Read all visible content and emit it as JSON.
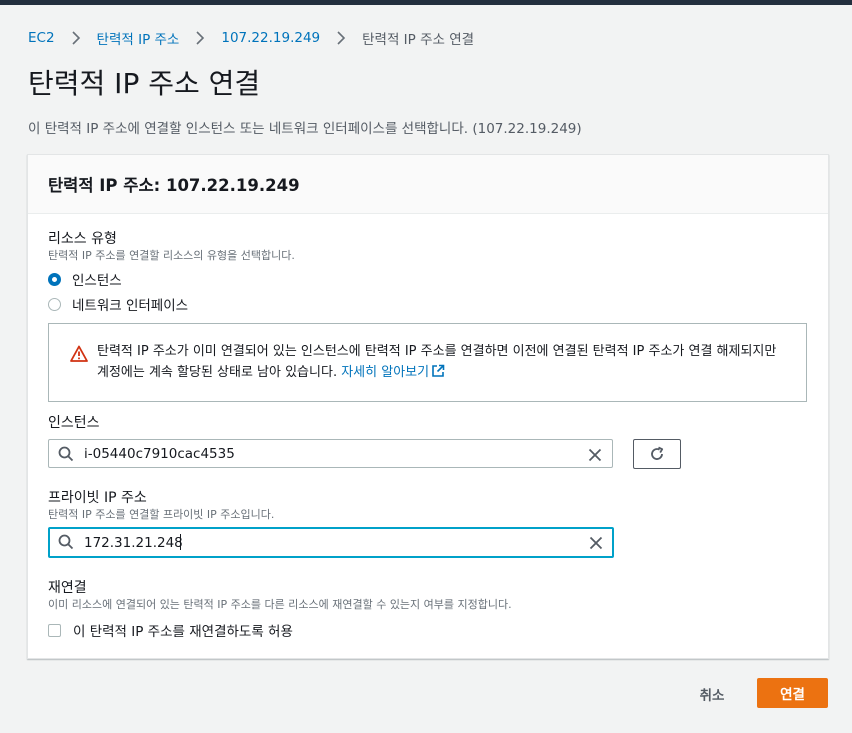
{
  "breadcrumb": {
    "items": [
      "EC2",
      "탄력적 IP 주소",
      "107.22.19.249"
    ],
    "current": "탄력적 IP 주소 연결"
  },
  "page": {
    "title": "탄력적 IP 주소 연결",
    "description": "이 탄력적 IP 주소에 연결할 인스턴스 또는 네트워크 인터페이스를 선택합니다. (107.22.19.249)"
  },
  "card": {
    "title": "탄력적 IP 주소: 107.22.19.249"
  },
  "resource_type": {
    "label": "리소스 유형",
    "description": "탄력적 IP 주소를 연결할 리소스의 유형을 선택합니다.",
    "options": [
      "인스턴스",
      "네트워크 인터페이스"
    ],
    "selected": "인스턴스"
  },
  "alert": {
    "text": "탄력적 IP 주소가 이미 연결되어 있는 인스턴스에 탄력적 IP 주소를 연결하면 이전에 연결된 탄력적 IP 주소가 연결 해제되지만 계정에는 계속 할당된 상태로 남아 있습니다. ",
    "link": "자세히 알아보기"
  },
  "instance": {
    "label": "인스턴스",
    "value": "i-05440c7910cac4535"
  },
  "private_ip": {
    "label": "프라이빗 IP 주소",
    "description": "탄력적 IP 주소를 연결할 프라이빗 IP 주소입니다.",
    "value": "172.31.21.248"
  },
  "reassociate": {
    "label": "재연결",
    "description": "이미 리소스에 연결되어 있는 탄력적 IP 주소를 다른 리소스에 재연결할 수 있는지 여부를 지정합니다.",
    "checkbox_label": "이 탄력적 IP 주소를 재연결하도록 허용",
    "checked": false
  },
  "actions": {
    "cancel": "취소",
    "associate": "연결"
  },
  "colors": {
    "primary": "#ec7211",
    "link": "#0073bb",
    "focus": "#00a1c9",
    "warning": "#d13212",
    "header": "#232f3e"
  }
}
